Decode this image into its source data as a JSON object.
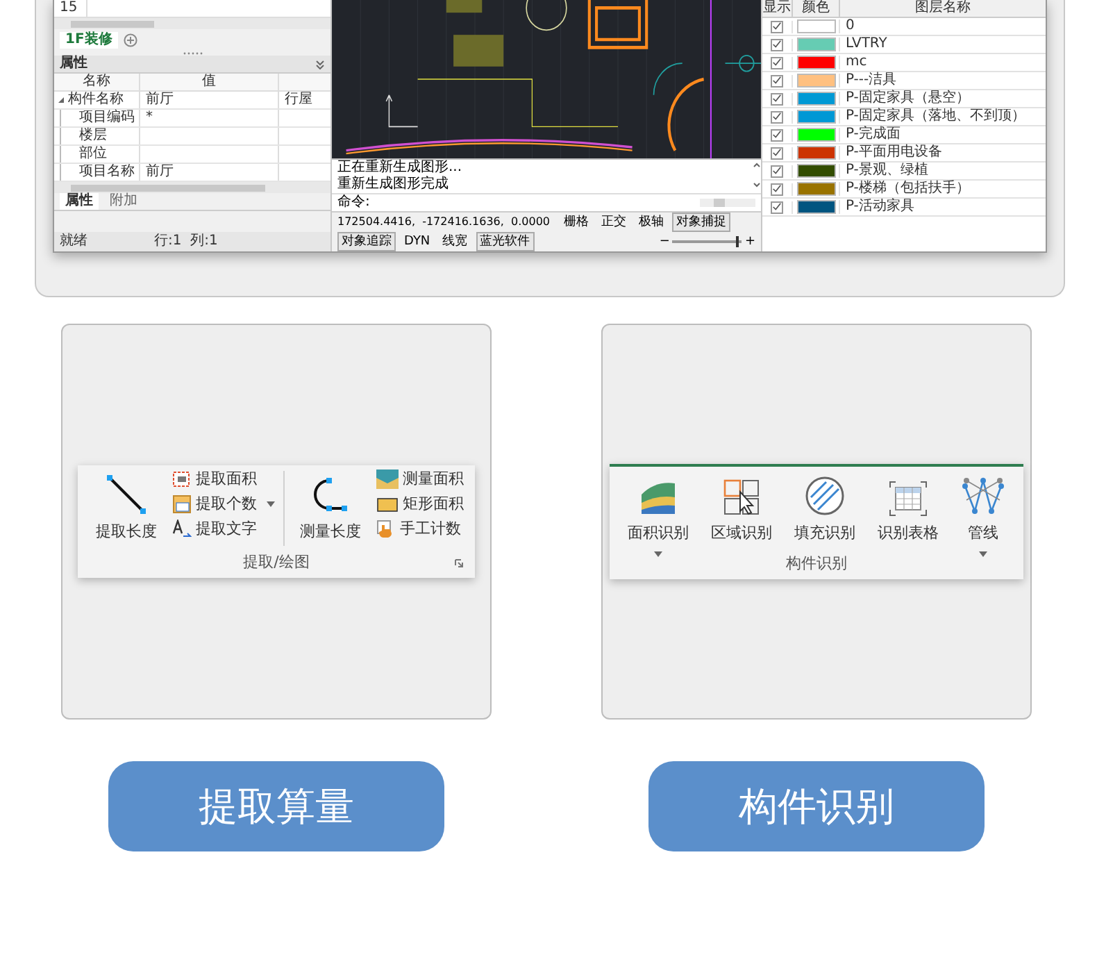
{
  "app_window": {
    "grid_cell": "15",
    "sheet_tab": {
      "label": "1F装修"
    },
    "properties": {
      "title": "属性",
      "columns": [
        "名称",
        "值"
      ],
      "rows": [
        {
          "name": "构件名称",
          "value": "前厅",
          "extra": "行屋",
          "expanded": true,
          "children": [
            {
              "name": "项目编码",
              "value": "*"
            },
            {
              "name": "楼层"
            },
            {
              "name": "部位"
            },
            {
              "name": "项目名称",
              "value": "前厅"
            }
          ]
        }
      ]
    },
    "bottom_tabs": [
      {
        "label": "属性",
        "selected": true
      },
      {
        "label": "附加",
        "selected": false
      }
    ],
    "status": {
      "state": "就绪",
      "position": "行:1  列:1"
    },
    "command_lines": [
      "正在重新生成图形...",
      "重新生成图形完成"
    ],
    "command_prompt": "命令:",
    "zoom": {
      "minus": "−",
      "plus": "+",
      "level": 0.94
    },
    "coordinates": "172504.4416,  -172416.1636,  0.0000",
    "toggles": [
      {
        "label": "栅格",
        "on": false
      },
      {
        "label": "正交",
        "on": false
      },
      {
        "label": "极轴",
        "on": false
      },
      {
        "label": "对象捕捉",
        "on": true
      },
      {
        "label": "对象追踪",
        "on": true
      },
      {
        "label": "DYN",
        "on": false
      },
      {
        "label": "线宽",
        "on": false
      },
      {
        "label": "蓝光软件",
        "on": true
      }
    ],
    "layers": {
      "columns": [
        "显示",
        "颜色",
        "图层名称"
      ],
      "rows": [
        {
          "name": "0",
          "visible": true,
          "color": "#ffffff"
        },
        {
          "name": "LVTRY",
          "visible": true,
          "color": "#66ccb3"
        },
        {
          "name": "mc",
          "visible": true,
          "color": "#ff0000"
        },
        {
          "name": "P---洁具",
          "visible": true,
          "color": "#ffc080"
        },
        {
          "name": "P-固定家具（悬空）",
          "visible": true,
          "color": "#0099d4"
        },
        {
          "name": "P-固定家具（落地、不到顶）",
          "visible": true,
          "color": "#0098d5"
        },
        {
          "name": "P-完成面",
          "visible": true,
          "color": "#00ff00"
        },
        {
          "name": "P-平面用电设备",
          "visible": true,
          "color": "#cc3300"
        },
        {
          "name": "P-景观、绿植",
          "visible": true,
          "color": "#334d00"
        },
        {
          "name": "P-楼梯（包括扶手）",
          "visible": true,
          "color": "#997300"
        },
        {
          "name": "P-活动家具",
          "visible": true,
          "color": "#005580"
        }
      ]
    }
  },
  "ribbons": [
    {
      "title": "提取/绘图",
      "items": [
        {
          "kind": "large",
          "label": "提取长度",
          "dropdown": false
        },
        {
          "kind": "small",
          "label": "提取面积",
          "dropdown": false
        },
        {
          "kind": "small",
          "label": "提取个数",
          "dropdown": true
        },
        {
          "kind": "small",
          "label": "提取文字",
          "dropdown": false
        },
        {
          "kind": "separator"
        },
        {
          "kind": "large",
          "label": "测量长度",
          "dropdown": false
        },
        {
          "kind": "small",
          "label": "测量面积",
          "dropdown": false
        },
        {
          "kind": "small",
          "label": "矩形面积",
          "dropdown": false
        },
        {
          "kind": "small",
          "label": "手工计数",
          "dropdown": false
        }
      ]
    },
    {
      "title": "构件识别",
      "items": [
        {
          "kind": "large",
          "label": "面积识别",
          "dropdown": true
        },
        {
          "kind": "large",
          "label": "区域识别",
          "dropdown": false
        },
        {
          "kind": "large",
          "label": "填充识别",
          "dropdown": false
        },
        {
          "kind": "large",
          "label": "识别表格",
          "dropdown": false
        },
        {
          "kind": "large",
          "label": "管线",
          "dropdown": true
        }
      ]
    }
  ],
  "buttons": [
    "提取算量",
    "构件识别"
  ]
}
